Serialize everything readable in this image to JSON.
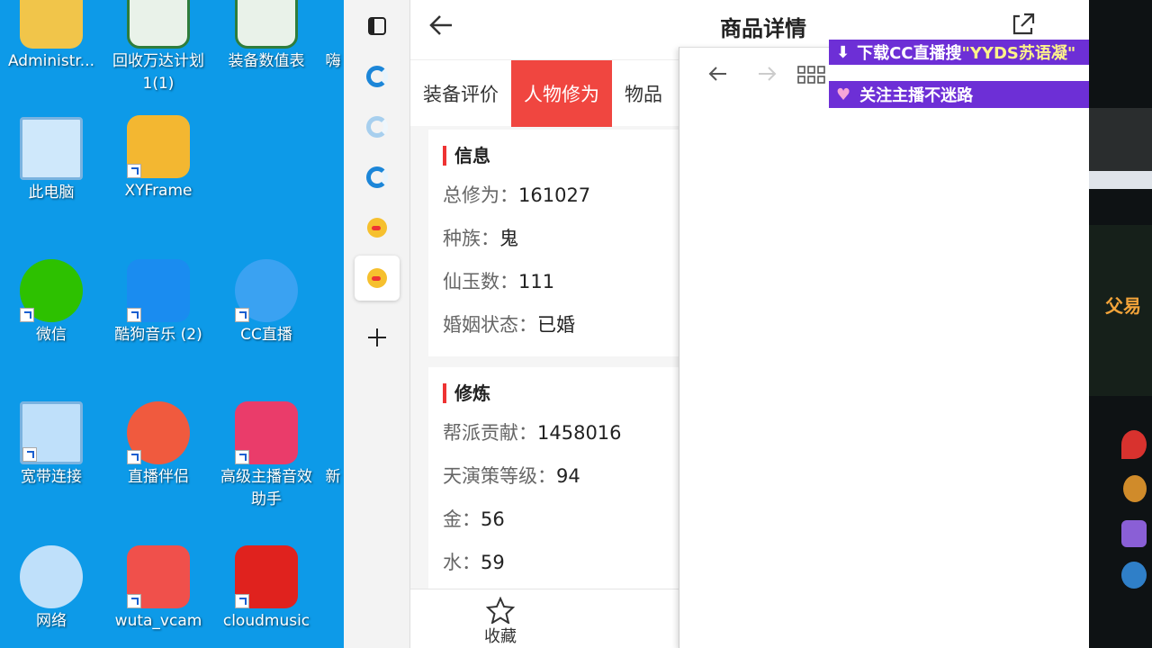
{
  "desktop": {
    "icons": [
      {
        "label": "Administr..."
      },
      {
        "label": "回收万达计划1(1)"
      },
      {
        "label": "装备数值表"
      },
      {
        "label": "嗨"
      },
      {
        "label": "此电脑"
      },
      {
        "label": "XYFrame"
      },
      {
        "label": "微信"
      },
      {
        "label": "酷狗音乐 (2)"
      },
      {
        "label": "CC直播"
      },
      {
        "label": "宽带连接"
      },
      {
        "label": "直播伴侣"
      },
      {
        "label": "高级主播音效助手"
      },
      {
        "label": "新"
      },
      {
        "label": "网络"
      },
      {
        "label": "wuta_vcam"
      },
      {
        "label": "cloudmusic"
      }
    ]
  },
  "header": {
    "title": "商品详情"
  },
  "tabs": [
    {
      "label": "装备评价"
    },
    {
      "label": "人物修为"
    },
    {
      "label": "物品"
    }
  ],
  "info_card": {
    "title": "信息",
    "rows": [
      {
        "key": "总修为：",
        "value": "161027"
      },
      {
        "key": "种族：",
        "value": "鬼"
      },
      {
        "key": "仙玉数：",
        "value": "111"
      },
      {
        "key": "婚姻状态：",
        "value": "已婚"
      }
    ]
  },
  "cultivation_card": {
    "title": "修炼",
    "rows": [
      {
        "key": "帮派贡献：",
        "value": "1458016"
      },
      {
        "key": "天演策等级：",
        "value": "94"
      },
      {
        "key": "金：",
        "value": "56"
      },
      {
        "key": "水：",
        "value": "59"
      }
    ]
  },
  "bottom": {
    "favorite_label": "收藏"
  },
  "banners": {
    "download_prefix": "下载CC直播搜 ",
    "download_highlight": "\"YYDS苏语凝\"",
    "follow": "关注主播不迷路"
  },
  "game_strip": {
    "label": "父易"
  },
  "colors": {
    "desktop_bg": "#0d9ae8",
    "active_tab": "#f04640",
    "banner_bg": "#6d2fd6",
    "banner_highlight": "#fdf38a"
  }
}
